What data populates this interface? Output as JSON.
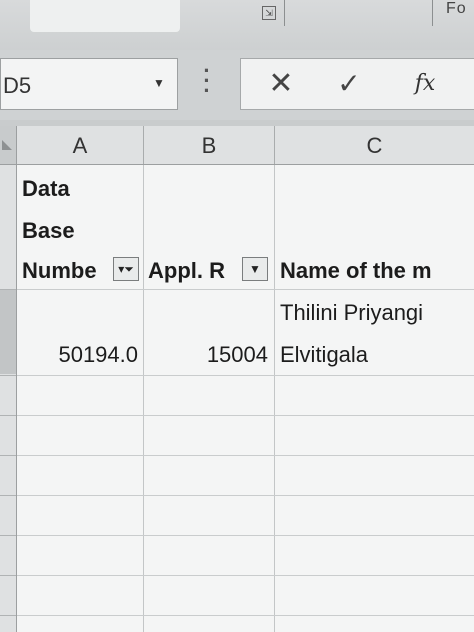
{
  "ribbon": {
    "partial_text": "Fo"
  },
  "formula_bar": {
    "name_box_value": "D5",
    "cancel_symbol": "✕",
    "enter_symbol": "✓",
    "fx_symbol": "fx"
  },
  "columns": [
    "A",
    "B",
    "C"
  ],
  "headers": {
    "col_a_lines": [
      "Data",
      "Base",
      "Numbe"
    ],
    "col_b": "Appl. R",
    "col_c": "Name of the m"
  },
  "rows": [
    {
      "col_a": "50194.0",
      "col_b": "15004",
      "col_c_lines": [
        "Thilini Priyangi",
        "Elvitigala"
      ]
    }
  ],
  "filters": {
    "col_a_active": true,
    "col_b_active": false
  }
}
